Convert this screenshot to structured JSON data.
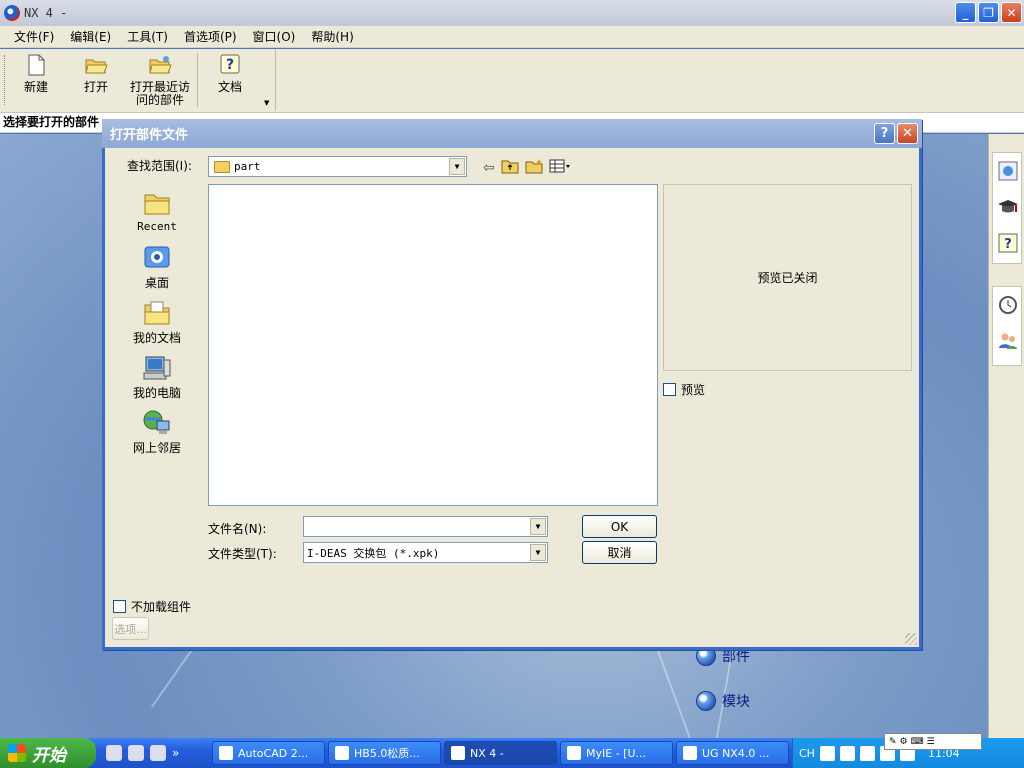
{
  "app": {
    "title": "NX 4 -",
    "window_controls": {
      "minimize": "_",
      "restore": "❐",
      "close": "✕"
    }
  },
  "menu": [
    "文件(F)",
    "编辑(E)",
    "工具(T)",
    "首选项(P)",
    "窗口(O)",
    "帮助(H)"
  ],
  "toolbar": {
    "new_label": "新建",
    "open_label": "打开",
    "recent_label_1": "打开最近访",
    "recent_label_2": "问的部件",
    "docs_label": "文档"
  },
  "status": {
    "prompt": "选择要打开的部件"
  },
  "background_links": {
    "part": "部件",
    "module": "模块"
  },
  "dialog": {
    "title": "打开部件文件",
    "help_btn": "?",
    "close_btn": "✕",
    "look_in_label": "查找范围(I):",
    "look_in_value": "part",
    "places": [
      "Recent",
      "桌面",
      "我的文档",
      "我的电脑",
      "网上邻居"
    ],
    "preview_text": "预览已关闭",
    "preview_checkbox": "预览",
    "filename_label": "文件名(N):",
    "filename_value": "",
    "filetype_label": "文件类型(T):",
    "filetype_value": "I-DEAS 交换包 (*.xpk)",
    "ok_button": "OK",
    "cancel_button": "取消",
    "no_load_components": "不加载组件",
    "options_button": "选项..."
  },
  "taskbar": {
    "start_label": "开始",
    "quick_more": "»",
    "tasks": [
      {
        "label": "AutoCAD 2...",
        "active": false
      },
      {
        "label": "HB5.0松质...",
        "active": false
      },
      {
        "label": "NX 4 -",
        "active": true
      },
      {
        "label": "MyIE - [U...",
        "active": false
      },
      {
        "label": "UG NX4.0 ...",
        "active": false
      }
    ],
    "tray": {
      "lang": "CH",
      "clock": "11:04"
    }
  }
}
